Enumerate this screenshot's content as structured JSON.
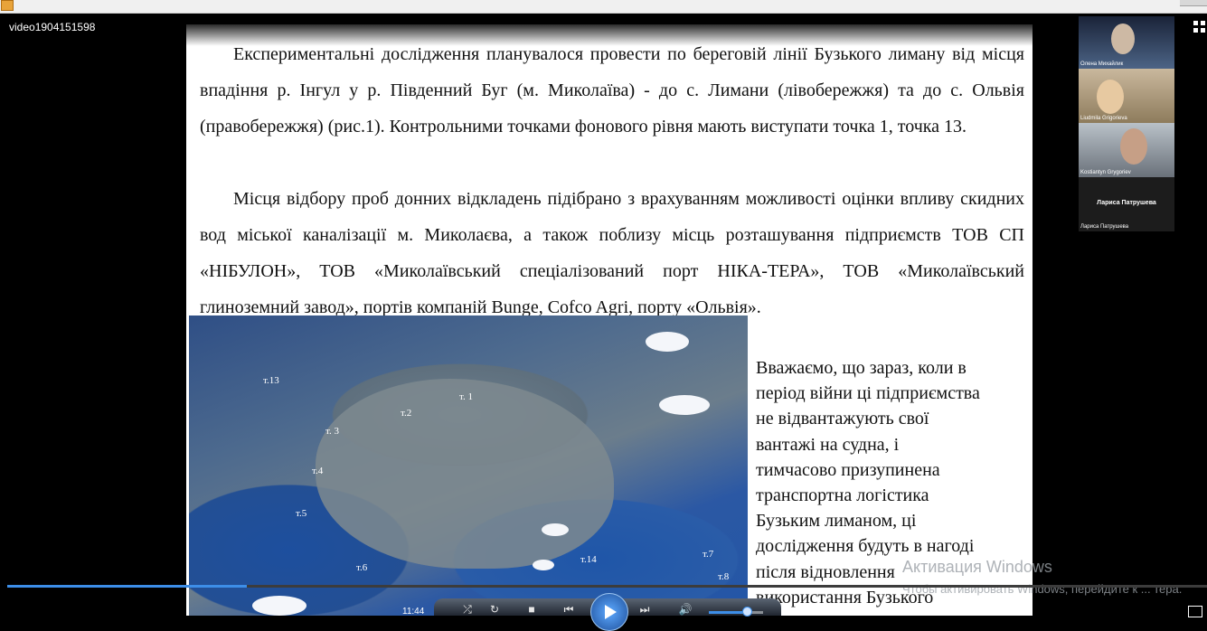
{
  "window": {
    "video_name": "video1904151598"
  },
  "slide": {
    "paragraph1": "Експериментальні дослідження планувалося провести по береговій лінії Бузького лиману від місця впадіння р. Інгул у р. Південний Буг (м. Миколаїва) - до с. Лимани (лівобережжя) та до с. Ольвія (правобережжя) (рис.1). Контрольними точками фонового рівня мають виступати точка 1,  точка 13.",
    "paragraph2": "Місця відбору проб донних відкладень підібрано з врахуванням можливості оцінки впливу скидних вод міської каналізації м. Миколаєва, а також поблизу місць розташування підприємств ТОВ СП «НІБУЛОН», ТОВ «Миколаївський спеціалізований порт НІКА-ТЕРА», ТОВ «Миколаївський глиноземний завод», портів компаній Bunge, Cofco Agri, порту «Ольвія».",
    "side_text": "Вважаємо, що зараз, коли в\nперіод війни ці підприємства\nне відвантажують свої\nвантажі на судна, і\nтимчасово призупинена\nтранспортна логістика\nБузьким лиманом, ці\nдослідження будуть в нагоді\nпісля відновлення\nвикористання Бузького",
    "map_labels": [
      "т.13",
      "т. 1",
      "т.2",
      "т. 3",
      "т.4",
      "т.5",
      "т.6",
      "т.14",
      "т.7",
      "т.8"
    ]
  },
  "participants": [
    {
      "name": "Олена Михайлик"
    },
    {
      "name": "Liudmila Grigorieva"
    },
    {
      "name": "Kostiantyn Grygoriev"
    },
    {
      "name": "Лариса Патрушева",
      "center_label": "Лариса Патрушева"
    }
  ],
  "activation": {
    "title": "Активация Windows",
    "subtitle": "Чтобы активировать Windows, перейдите к ... тера."
  },
  "player": {
    "current_time": "11:44",
    "progress": 0.2,
    "volume": 0.62,
    "stray_text": "0"
  },
  "colors": {
    "accent": "#3d8ee8",
    "background": "#000000",
    "slide_background": "#ffffff"
  }
}
